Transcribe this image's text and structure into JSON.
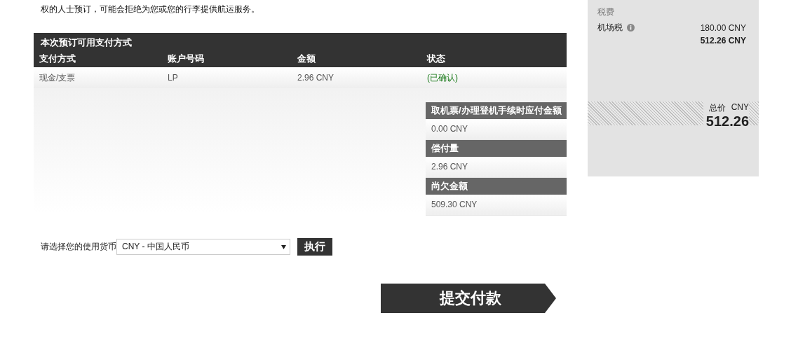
{
  "notice": "权的人士预订，可能会拒绝为您或您的行李提供航运服务。",
  "payment_table": {
    "title": "本次预订可用支付方式",
    "columns": [
      "支付方式",
      "账户号码",
      "金额",
      "状态"
    ],
    "rows": [
      {
        "method": "现金/支票",
        "account": "LP",
        "amount": "2.96 CNY",
        "status": "(已确认)"
      }
    ]
  },
  "summary": [
    {
      "label": "取机票/办理登机手续时应付金额",
      "value": "0.00 CNY"
    },
    {
      "label": "偿付量",
      "value": "2.96 CNY"
    },
    {
      "label": "尚欠金额",
      "value": "509.30 CNY"
    }
  ],
  "currency": {
    "label": "请选择您的使用货币",
    "value": "CNY - 中国人民币",
    "button": "执行"
  },
  "submit_button": "提交付款",
  "fare_panel": {
    "section": "税费",
    "tax_label": "机场税",
    "tax_value": "180.00 CNY",
    "subtotal": "512.26 CNY",
    "total_label": "总价",
    "total_currency": "CNY",
    "total_value": "512.26"
  }
}
